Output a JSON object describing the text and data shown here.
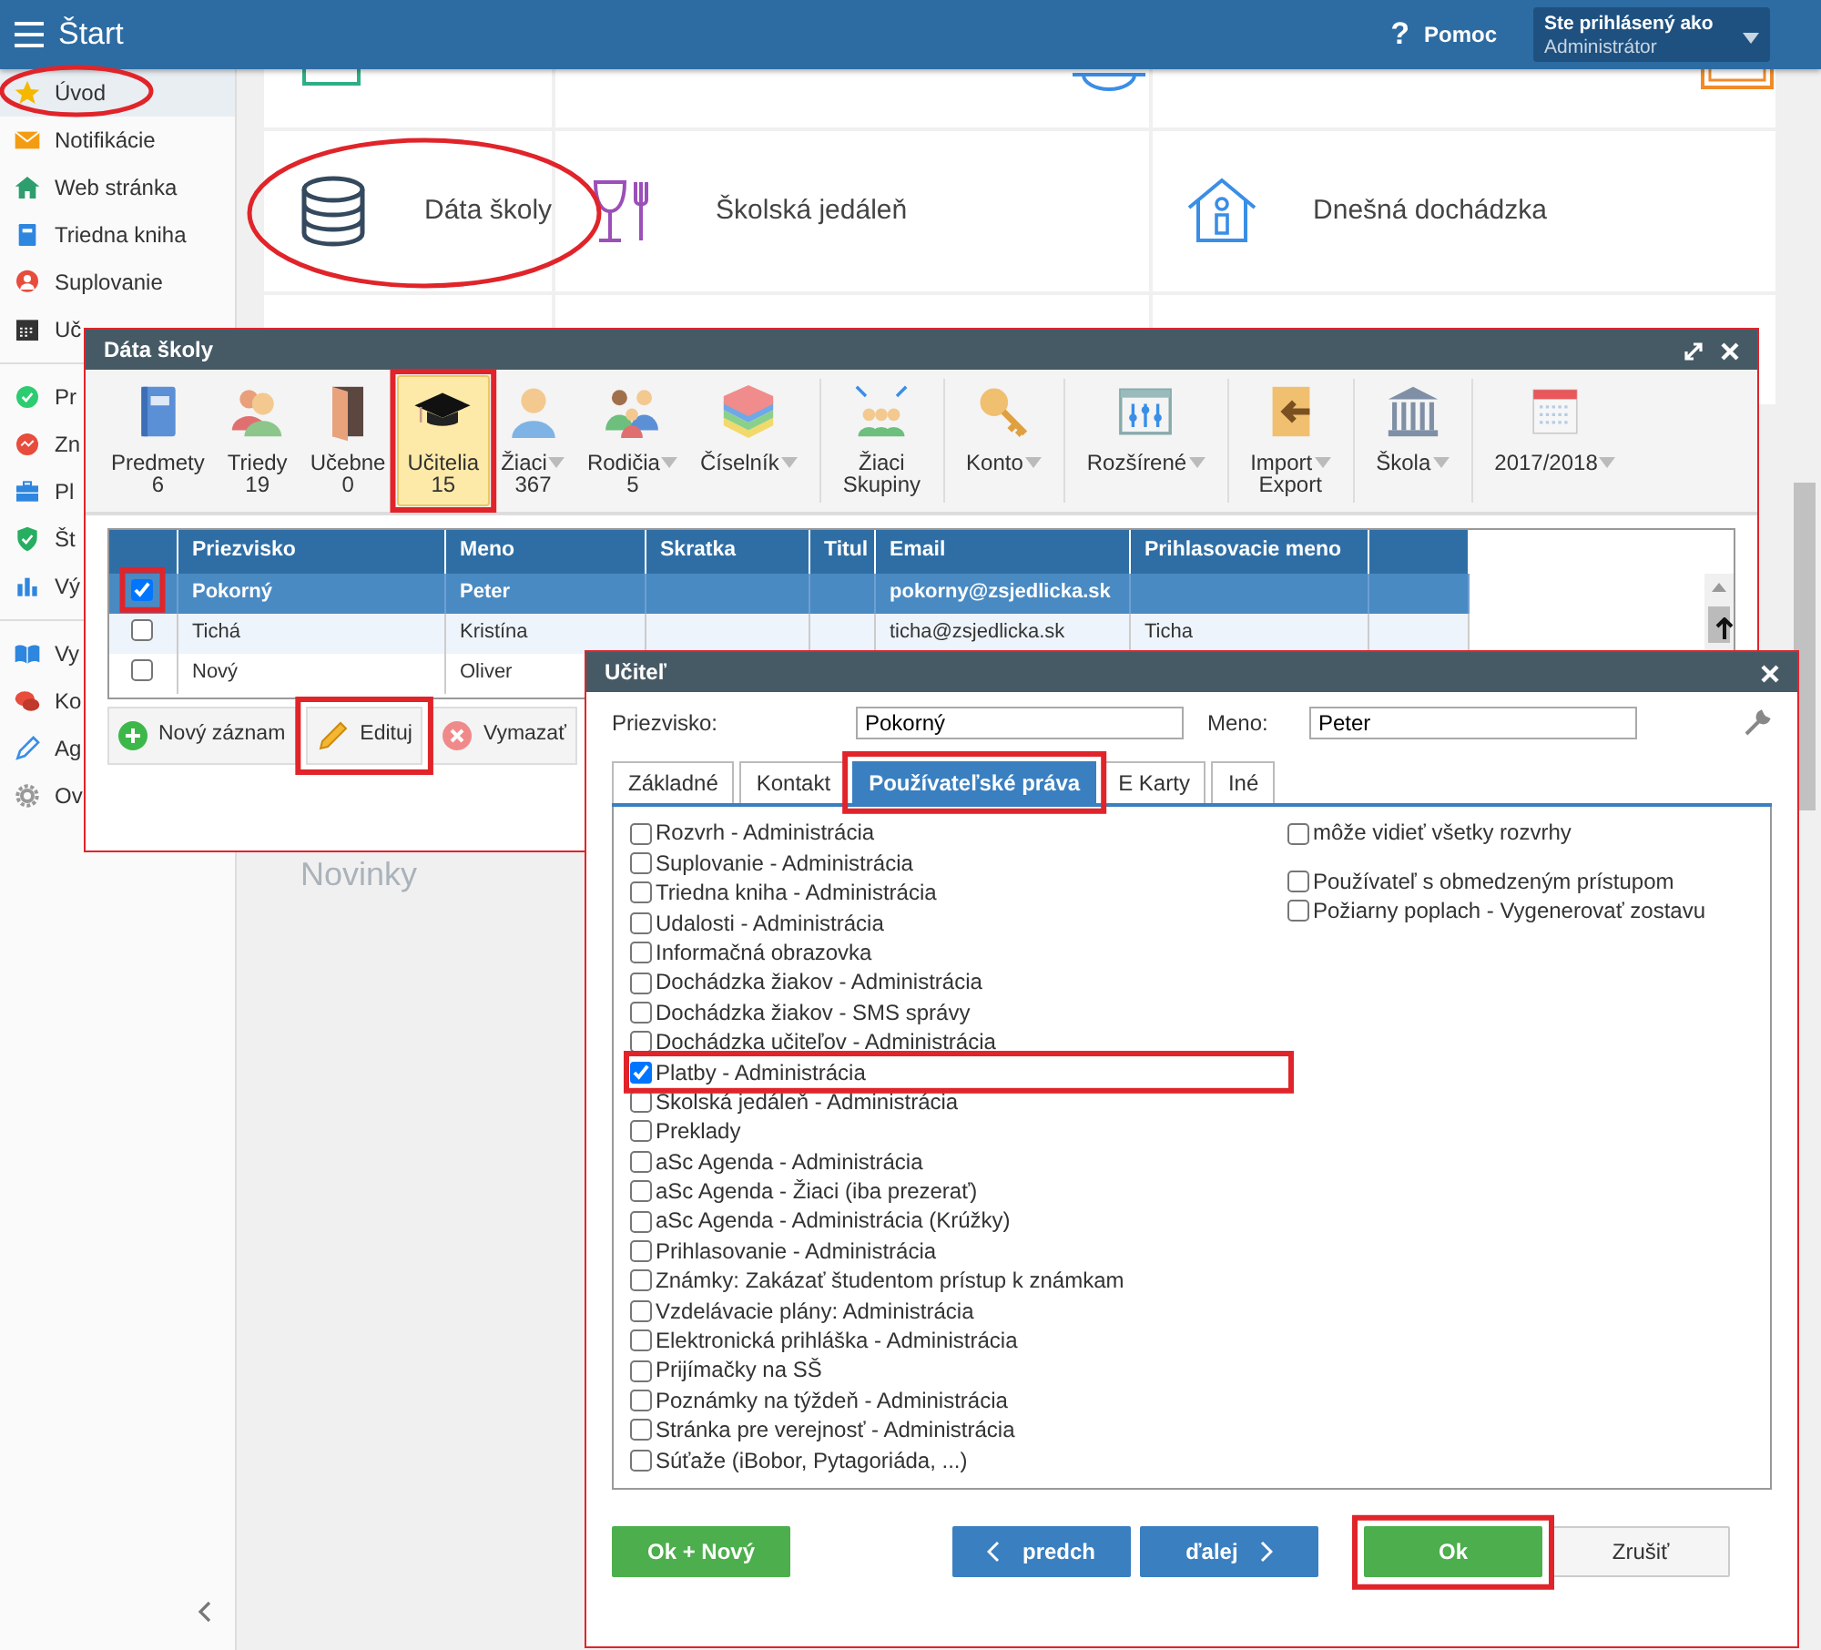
{
  "app_bar": {
    "title": "Štart",
    "help_icon": "?",
    "help": "Pomoc",
    "user_label": "Ste prihlásený ako",
    "user_name": "Administrátor"
  },
  "sidebar": {
    "items": [
      {
        "label": "Úvod",
        "selected": true,
        "separator_before": false
      },
      {
        "label": "Notifikácie",
        "selected": false,
        "separator_before": false
      },
      {
        "label": "Web stránka",
        "selected": false,
        "separator_before": false
      },
      {
        "label": "Triedna kniha",
        "selected": false,
        "separator_before": false
      },
      {
        "label": "Suplovanie",
        "selected": false,
        "separator_before": false
      },
      {
        "label": "Uč",
        "selected": false,
        "separator_before": false
      },
      {
        "label": "Pr",
        "selected": false,
        "separator_before": true
      },
      {
        "label": "Zn",
        "selected": false,
        "separator_before": false
      },
      {
        "label": "Pl",
        "selected": false,
        "separator_before": false
      },
      {
        "label": "Št",
        "selected": false,
        "separator_before": false
      },
      {
        "label": "Vý",
        "selected": false,
        "separator_before": false
      },
      {
        "label": "Vy",
        "selected": false,
        "separator_before": true
      },
      {
        "label": "Ko",
        "selected": false,
        "separator_before": false
      },
      {
        "label": "Ag",
        "selected": false,
        "separator_before": false
      },
      {
        "label": "Ov",
        "selected": false,
        "separator_before": false
      }
    ]
  },
  "tiles": [
    {
      "label": "Dáta školy"
    },
    {
      "label": "Školská jedáleň"
    },
    {
      "label": "Dnešná dochádzka"
    }
  ],
  "news_heading": "Novinky",
  "data_dialog": {
    "title": "Dáta školy",
    "toolbar": [
      {
        "label": "Predmety",
        "sublabel": "6",
        "selected": false,
        "dropdown": false,
        "separator_before": false
      },
      {
        "label": "Triedy",
        "sublabel": "19",
        "selected": false,
        "dropdown": false,
        "separator_before": false
      },
      {
        "label": "Učebne",
        "sublabel": "0",
        "selected": false,
        "dropdown": false,
        "separator_before": false
      },
      {
        "label": "Učitelia",
        "sublabel": "15",
        "selected": true,
        "dropdown": false,
        "separator_before": false
      },
      {
        "label": "Žiaci",
        "sublabel": "367",
        "selected": false,
        "dropdown": true,
        "separator_before": false
      },
      {
        "label": "Rodičia",
        "sublabel": "5",
        "selected": false,
        "dropdown": true,
        "separator_before": false
      },
      {
        "label": "Číselník",
        "selected": false,
        "dropdown": true,
        "separator_before": false
      },
      {
        "label": "Žiaci",
        "sublabel": "Skupiny",
        "selected": false,
        "dropdown": false,
        "separator_before": true
      },
      {
        "label": "Konto",
        "selected": false,
        "dropdown": true,
        "separator_before": true
      },
      {
        "label": "Rozšírené",
        "selected": false,
        "dropdown": true,
        "separator_before": true
      },
      {
        "label": "Import",
        "sublabel": "Export",
        "selected": false,
        "dropdown": true,
        "separator_before": true
      },
      {
        "label": "Škola",
        "selected": false,
        "dropdown": true,
        "separator_before": true
      },
      {
        "label": "2017/2018",
        "selected": false,
        "dropdown": true,
        "separator_before": true
      }
    ],
    "table": {
      "columns": [
        "Priezvisko",
        "Meno",
        "Skratka",
        "Titul",
        "Email",
        "Prihlasovacie meno"
      ],
      "rows": [
        {
          "selected": true,
          "checked": true,
          "cells": [
            "Pokorný",
            "Peter",
            null,
            null,
            "pokorny@zsjedlicka.sk",
            null
          ]
        },
        {
          "selected": false,
          "checked": false,
          "cells": [
            "Tichá",
            "Kristína",
            null,
            null,
            "ticha@zsjedlicka.sk",
            "Ticha"
          ]
        },
        {
          "selected": false,
          "checked": false,
          "cells": [
            "Nový",
            "Oliver"
          ]
        }
      ]
    },
    "buttons": [
      {
        "label": "Nový záznam",
        "kind": "add"
      },
      {
        "label": "Edituj",
        "kind": "edit"
      },
      {
        "label": "Vymazať",
        "kind": "delete"
      }
    ]
  },
  "teacher_dialog": {
    "title": "Učiteľ",
    "fields": [
      {
        "label": "Priezvisko:",
        "value": "Pokorný"
      },
      {
        "label": "Meno:",
        "value": "Peter"
      }
    ],
    "tabs": [
      {
        "label": "Základné",
        "selected": false
      },
      {
        "label": "Kontakt",
        "selected": false
      },
      {
        "label": "Používateľské práva",
        "selected": true
      },
      {
        "label": "E Karty",
        "selected": false
      },
      {
        "label": "Iné",
        "selected": false
      }
    ],
    "permissions_left": [
      {
        "label": "Rozvrh - Administrácia",
        "checked": false
      },
      {
        "label": "Suplovanie - Administrácia",
        "checked": false
      },
      {
        "label": "Triedna kniha - Administrácia",
        "checked": false
      },
      {
        "label": "Udalosti - Administrácia",
        "checked": false
      },
      {
        "label": "Informačná obrazovka",
        "checked": false
      },
      {
        "label": "Dochádzka žiakov - Administrácia",
        "checked": false
      },
      {
        "label": "Dochádzka žiakov - SMS správy",
        "checked": false
      },
      {
        "label": "Dochádzka učiteľov - Administrácia",
        "checked": false
      },
      {
        "label": "Platby - Administrácia",
        "checked": true
      },
      {
        "label": "Školská jedáleň - Administrácia",
        "checked": false
      },
      {
        "label": "Preklady",
        "checked": false
      },
      {
        "label": "aSc Agenda - Administrácia",
        "checked": false
      },
      {
        "label": "aSc Agenda - Žiaci (iba prezerať)",
        "checked": false
      },
      {
        "label": "aSc Agenda - Administrácia (Krúžky)",
        "checked": false
      },
      {
        "label": "Prihlasovanie - Administrácia",
        "checked": false
      },
      {
        "label": "Známky: Zakázať študentom prístup k známkam",
        "checked": false
      },
      {
        "label": "Vzdelávacie plány: Administrácia",
        "checked": false
      },
      {
        "label": "Elektronická prihláška - Administrácia",
        "checked": false
      },
      {
        "label": "Prijímačky na SŠ",
        "checked": false
      },
      {
        "label": "Poznámky na týždeň - Administrácia",
        "checked": false
      },
      {
        "label": "Stránka pre verejnosť - Administrácia",
        "checked": false
      },
      {
        "label": "Súťaže (iBobor, Pytagoriáda, ...)",
        "checked": false
      }
    ],
    "permissions_right": [
      {
        "label": "môže vidieť všetky rozvrhy",
        "checked": false
      },
      {
        "label": "Používateľ s obmedzeným prístupom",
        "checked": false
      },
      {
        "label": "Požiarny poplach - Vygenerovať zostavu",
        "checked": false
      }
    ],
    "buttons": [
      {
        "label": "Ok + Nový",
        "kind": "success"
      },
      {
        "label": "predch",
        "kind": "prev"
      },
      {
        "label": "ďalej",
        "kind": "next"
      },
      {
        "label": "Ok",
        "kind": "success"
      },
      {
        "label": "Zrušiť",
        "kind": "cancel"
      }
    ]
  }
}
